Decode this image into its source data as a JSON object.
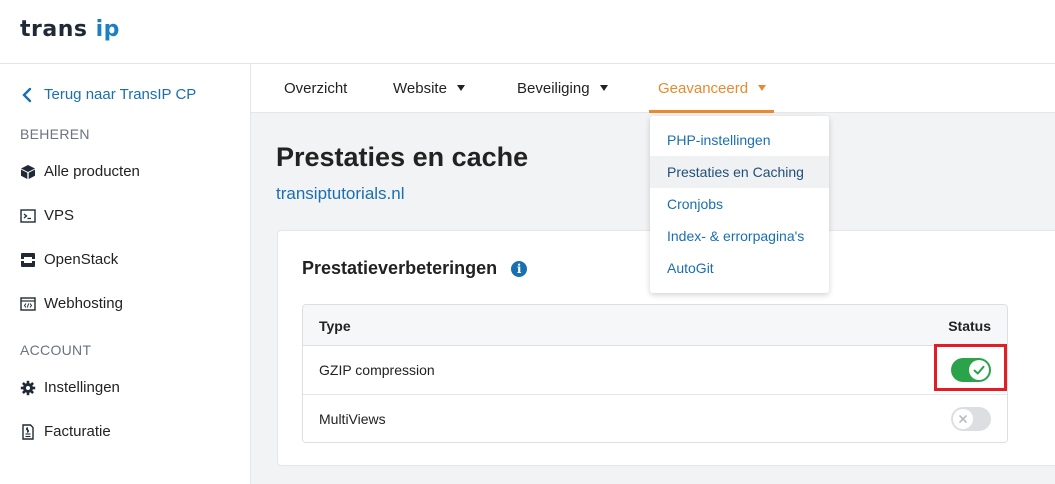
{
  "brand": {
    "logo_main": "trans",
    "logo_accent": "ip"
  },
  "sidebar": {
    "back_label": "Terug naar TransIP CP",
    "section_manage": "BEHEREN",
    "manage_items": [
      {
        "label": "Alle producten",
        "icon": "cube-icon"
      },
      {
        "label": "VPS",
        "icon": "terminal-icon"
      },
      {
        "label": "OpenStack",
        "icon": "server-icon"
      },
      {
        "label": "Webhosting",
        "icon": "code-window-icon"
      }
    ],
    "section_account": "ACCOUNT",
    "account_items": [
      {
        "label": "Instellingen",
        "icon": "gear-icon"
      },
      {
        "label": "Facturatie",
        "icon": "invoice-icon"
      }
    ]
  },
  "tabs": [
    {
      "label": "Overzicht",
      "dropdown": false
    },
    {
      "label": "Website",
      "dropdown": true
    },
    {
      "label": "Beveiliging",
      "dropdown": true
    },
    {
      "label": "Geavanceerd",
      "dropdown": true,
      "active": true
    }
  ],
  "dropdown": {
    "items": [
      "PHP-instellingen",
      "Prestaties en Caching",
      "Cronjobs",
      "Index- & errorpagina's",
      "AutoGit"
    ],
    "hovered": "Prestaties en Caching"
  },
  "page": {
    "title": "Prestaties en cache",
    "domain": "transiptutorials.nl"
  },
  "card": {
    "title": "Prestatieverbeteringen",
    "columns": {
      "type": "Type",
      "status": "Status"
    },
    "rows": [
      {
        "type": "GZIP compression",
        "enabled": true
      },
      {
        "type": "MultiViews",
        "enabled": false
      }
    ]
  },
  "colors": {
    "accent": "#e98a2e",
    "link": "#1a6fb0",
    "toggle_on": "#2aa34a",
    "highlight": "#e41c24"
  }
}
